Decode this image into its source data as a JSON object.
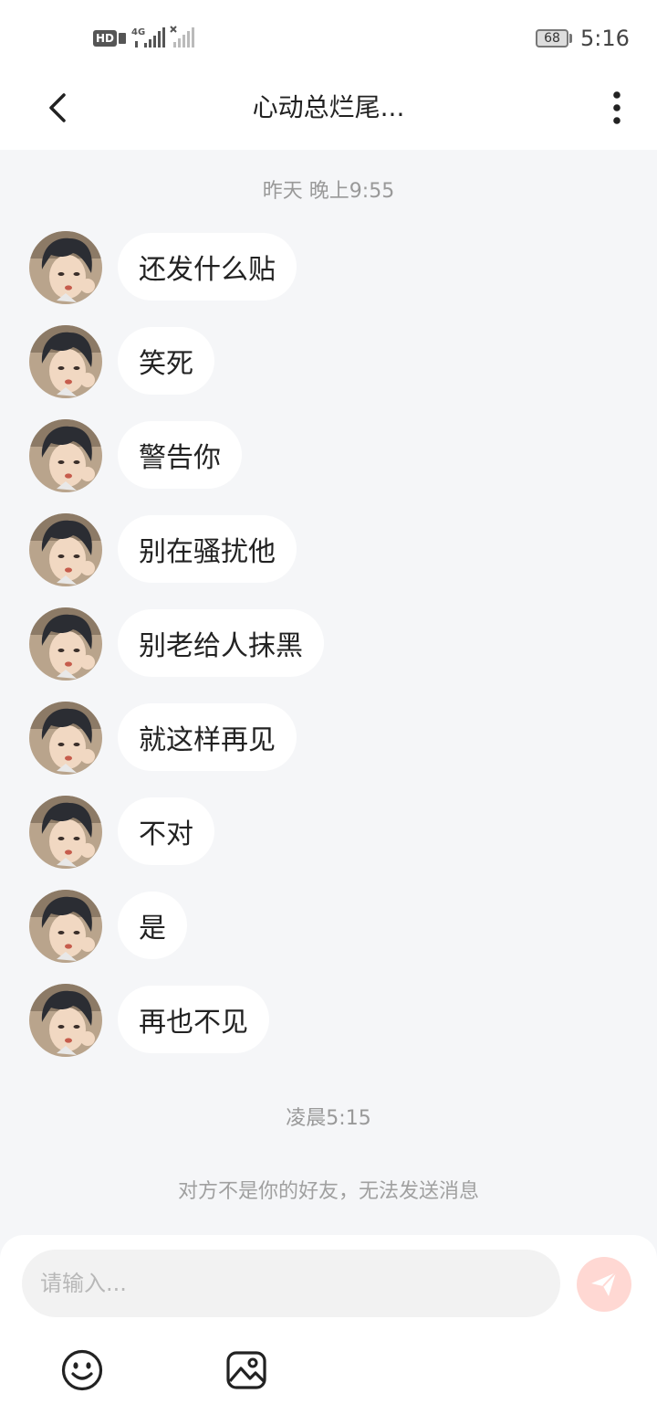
{
  "status_bar": {
    "hd_label": "HD",
    "network_label": "4G",
    "battery_level": "68",
    "time": "5:16"
  },
  "header": {
    "title": "心动总烂尾..."
  },
  "chat": {
    "timestamp_1": "昨天 晚上9:55",
    "messages": [
      {
        "text": "还发什么贴"
      },
      {
        "text": "笑死"
      },
      {
        "text": "警告你"
      },
      {
        "text": "别在骚扰他"
      },
      {
        "text": "别老给人抹黑"
      },
      {
        "text": "就这样再见"
      },
      {
        "text": "不对"
      },
      {
        "text": "是"
      },
      {
        "text": "再也不见"
      }
    ],
    "timestamp_2": "凌晨5:15",
    "notice": "对方不是你的好友，无法发送消息"
  },
  "input": {
    "placeholder": "请输入..."
  },
  "colors": {
    "page_background": "#f5f6f8",
    "bubble_background": "#ffffff",
    "send_button_disabled": "#ffd8d3",
    "muted_text": "#999999"
  },
  "icons": {
    "back": "back-arrow-icon",
    "more": "more-vertical-icon",
    "send": "send-icon",
    "emoji": "emoji-icon",
    "image": "image-icon"
  }
}
